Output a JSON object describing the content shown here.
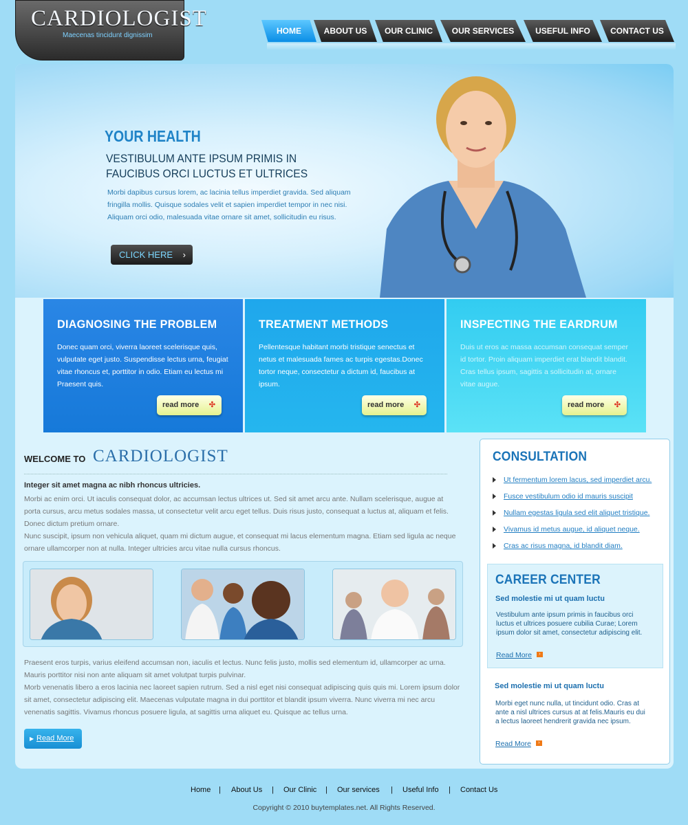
{
  "logo": {
    "title": "CARDIOLOGIST",
    "tagline": "Maecenas tincidunt dignissim"
  },
  "nav": [
    "HOME",
    "ABOUT US",
    "OUR CLINIC",
    "OUR SERVICES",
    "USEFUL INFO",
    "CONTACT US"
  ],
  "hero": {
    "title": "YOUR HEALTH",
    "subtitle": "VESTIBULUM ANTE IPSUM PRIMIS IN FAUCIBUS ORCI LUCTUS ET ULTRICES",
    "text": "Morbi dapibus cursus lorem, ac lacinia tellus imperdiet gravida. Sed aliquam fringilla mollis. Quisque sodales velit et sapien imperdiet tempor in nec nisi. Aliquam orci odio, malesuada vitae ornare sit amet, sollicitudin eu risus.",
    "button": "CLICK HERE"
  },
  "features": [
    {
      "title": "DIAGNOSING THE PROBLEM",
      "text": "Donec quam orci, viverra laoreet scelerisque quis, vulputate eget justo. Suspendisse lectus urna, feugiat vitae rhoncus et, porttitor in odio. Etiam eu lectus mi  Praesent quis.",
      "button": "read more"
    },
    {
      "title": "TREATMENT METHODS",
      "text": "Pellentesque habitant morbi tristique senectus et netus et malesuada fames ac turpis egestas.Donec tortor neque, consectetur a dictum id, faucibus at ipsum.",
      "button": "read more"
    },
    {
      "title": "INSPECTING THE EARDRUM",
      "text": "Duis ut eros ac massa accumsan consequat semper id tortor. Proin aliquam imperdiet erat blandit blandit. Cras tellus ipsum, sagittis a sollicitudin at, ornare vitae augue.",
      "button": "read more"
    }
  ],
  "welcome": {
    "prefix": "WELCOME TO",
    "name": "CARDIOLOGIST",
    "heading": "Integer sit amet magna ac nibh rhoncus ultricies.",
    "para1": "Morbi ac enim orci. Ut iaculis consequat dolor, ac accumsan lectus ultrices ut. Sed sit amet arcu ante. Nullam scelerisque, augue at porta cursus, arcu metus sodales massa, ut consectetur velit arcu eget tellus. Duis risus justo, consequat a luctus at, aliquam et felis. Donec dictum pretium ornare.",
    "para2": "Nunc suscipit, ipsum non vehicula aliquet, quam mi dictum augue, et consequat mi lacus elementum magna. Etiam sed ligula ac neque ornare ullamcorper non at nulla.  Integer ultricies arcu vitae nulla cursus rhoncus.",
    "para3": "Praesent eros turpis, varius eleifend accumsan non, iaculis et lectus. Nunc felis justo, mollis sed elementum id, ullamcorper ac urna. Mauris porttitor nisi non ante aliquam sit amet volutpat turpis pulvinar.",
    "para4": "Morb venenatis libero a eros lacinia nec laoreet sapien rutrum. Sed a nisl eget nisi consequat adipiscing quis quis mi. Lorem ipsum dolor sit amet, consectetur adipiscing elit. Maecenas vulputate magna in dui porttitor et blandit ipsum viverra. Nunc viverra mi nec arcu venenatis sagittis. Vivamus rhoncus posuere ligula, at sagittis urna aliquet eu. Quisque ac tellus urna.",
    "readmore": "Read More"
  },
  "consultation": {
    "title": "CONSULTATION",
    "links": [
      "Ut fermentum lorem lacus, sed imperdiet arcu.",
      "Fusce vestibulum odio id mauris suscipit",
      "Nullam egestas ligula sed elit aliquet tristique.",
      "Vivamus id metus augue, id aliquet neque.",
      "Cras ac risus magna, id blandit diam."
    ]
  },
  "career": {
    "title": "CAREER CENTER",
    "item1": {
      "heading": "Sed molestie mi ut quam luctu",
      "text": "Vestibulum ante ipsum primis in faucibus orci luctus et ultrices posuere cubilia Curae; Lorem ipsum dolor sit amet, consectetur adipiscing elit.",
      "link": "Read More"
    },
    "item2": {
      "heading": "Sed molestie mi ut quam luctu",
      "text": "Morbi eget nunc nulla, ut tincidunt odio. Cras at ante a nisl ultrices cursus at at felis.Mauris eu dui a lectus laoreet hendrerit gravida nec ipsum.",
      "link": "Read More"
    }
  },
  "footer": {
    "links": [
      "Home",
      "About Us",
      "Our Clinic",
      "Our services",
      "Useful Info",
      "Contact Us"
    ],
    "separator": "|",
    "copyright": "Copyright © 2010 buytemplates.net. All Rights Reserved."
  },
  "colors": {
    "accent": "#1f83c7",
    "background": "#9fdcf6",
    "nav_active": "#0a8ee6"
  }
}
